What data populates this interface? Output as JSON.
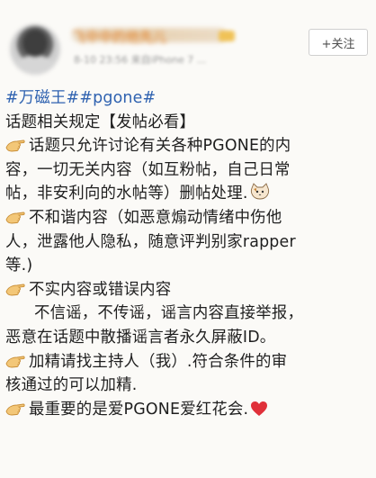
{
  "header": {
    "username": "飞中中的他先儿",
    "meta": "8-10 23:56  来自iPhone 7 ...",
    "follow_label": "+关注"
  },
  "post": {
    "tags": "#万磁王##pgone#",
    "line_rules_title": "话题相关规定【发帖必看】",
    "line_1a": "话题只允许讨论有关各种PGONE的内",
    "line_1b": "容，一切无关内容（如互粉帖，自己日常",
    "line_1c": "帖，非安利向的水帖等）删帖处理.",
    "line_2a": "不和谐内容（如恶意煽动情绪中伤他",
    "line_2b": "人，泄露他人隐私，随意评判别家rapper",
    "line_2c": "等.)",
    "line_3a": "不实内容或错误内容",
    "line_3b": "不信谣，不传谣，谣言内容直接举报，",
    "line_3c": "恶意在话题中散播谣言者永久屏蔽ID。",
    "line_4a": "加精请找主持人（我）.符合条件的审",
    "line_4b": "核通过的可以加精.",
    "line_5a": "最重要的是爱PGONE爱红花会."
  },
  "icons": {
    "bullet": "pointing-hand-icon",
    "cat": "cat-face-icon",
    "heart": "red-heart-icon"
  },
  "colors": {
    "tag": "#2f62b0",
    "username": "#e07b20",
    "heart": "#e0303a"
  }
}
